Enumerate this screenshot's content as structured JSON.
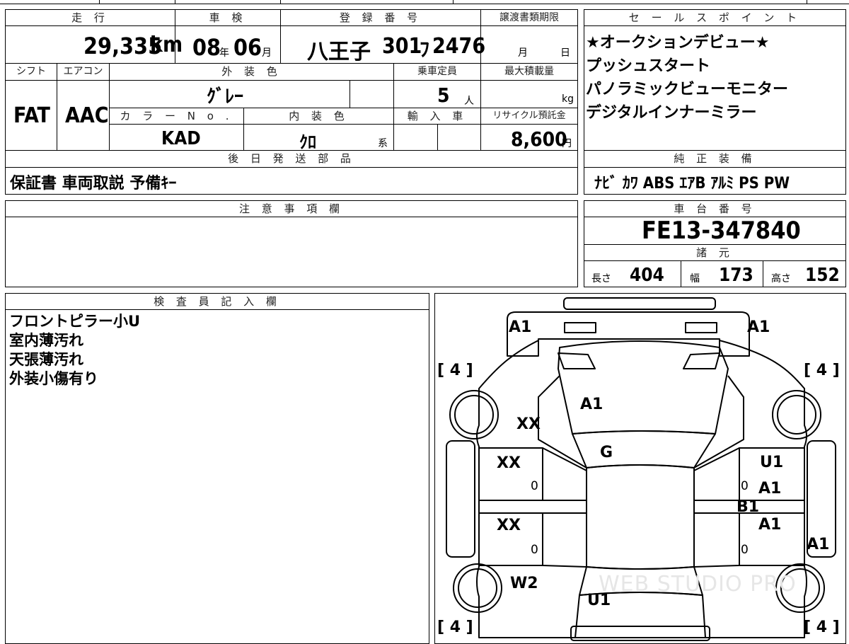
{
  "top_row": {
    "mileage": {
      "label": "走 行",
      "value": "29,335",
      "unit": "km"
    },
    "shaken": {
      "label": "車 検",
      "year": "08",
      "year_unit": "年",
      "month": "06",
      "month_unit": "月"
    },
    "registration": {
      "label": "登 録 番 号",
      "region": "八王子",
      "class_no": "301",
      "kana": "ﾌ",
      "number": "2476"
    },
    "transfer_deadline": {
      "label": "譲渡書類期限",
      "month_unit": "月",
      "day_unit": "日"
    }
  },
  "sales_points": {
    "label": "セ ー ル ス ポ イ ン ト",
    "lines": [
      "★オークションデビュー★",
      "プッシュスタート",
      "パノラミックビューモニター",
      "デジタルインナーミラー"
    ]
  },
  "spec_row": {
    "shift_label": "シフト",
    "shift": "FAT",
    "ac_label": "エアコン",
    "ac": "AAC",
    "exterior_color_label": "外 装 色",
    "exterior_color": "ｸﾞﾚｰ",
    "capacity_label": "乗車定員",
    "capacity": "5",
    "capacity_unit": "人",
    "max_load_label": "最大積載量",
    "max_load_unit": "kg",
    "color_no_label": "カ ラ ー N o .",
    "color_no": "KAD",
    "interior_color_label": "内 装 色",
    "interior_color": "ｸﾛ",
    "interior_suffix": "系",
    "import_label": "輸 入 車",
    "recycle_label": "リサイクル預託金",
    "recycle_fee": "8,600",
    "recycle_unit": "円"
  },
  "later_parts": {
    "label": "後 日 発 送 部 品",
    "value": "保証書 車両取説 予備ｷｰ"
  },
  "genuine_equipment": {
    "label": "純 正 装 備",
    "value": "ﾅﾋﾞ ｶﾜ ABS ｴｱB ｱﾙﾐ PS PW"
  },
  "notes": {
    "label": "注 意 事 項 欄"
  },
  "chassis": {
    "label": "車 台 番 号",
    "value": "FE13-347840"
  },
  "dimensions": {
    "label": "諸 元",
    "length_label": "長さ",
    "length": "404",
    "width_label": "幅",
    "width": "173",
    "height_label": "高さ",
    "height": "152"
  },
  "inspector": {
    "label": "検 査 員 記 入 欄",
    "lines": [
      "フロントピラー小U",
      "室内薄汚れ",
      "天張薄汚れ",
      "外装小傷有り"
    ]
  },
  "diagram": {
    "tire_tl": "[ 4 ]",
    "tire_tr": "[ 4 ]",
    "tire_bl": "[ 4 ]",
    "tire_br": "[ 4 ]",
    "marks": {
      "headlight_left": "A1",
      "headlight_right": "A1",
      "hood": "A1",
      "front_fender_left": "XX",
      "roof": "G",
      "front_door_left": "XX",
      "rear_door_left": "XX",
      "front_door_right": "U1",
      "front_door_right_2": "A1",
      "pillar_right": "B1",
      "rear_door_right": "A1",
      "rocker_right": "A1",
      "rear_fender_left": "W2",
      "trunk": "U1",
      "zero_1": "0",
      "zero_2": "0",
      "zero_3": "0",
      "zero_4": "0"
    },
    "watermark": "WEB STUDIO PRO"
  }
}
